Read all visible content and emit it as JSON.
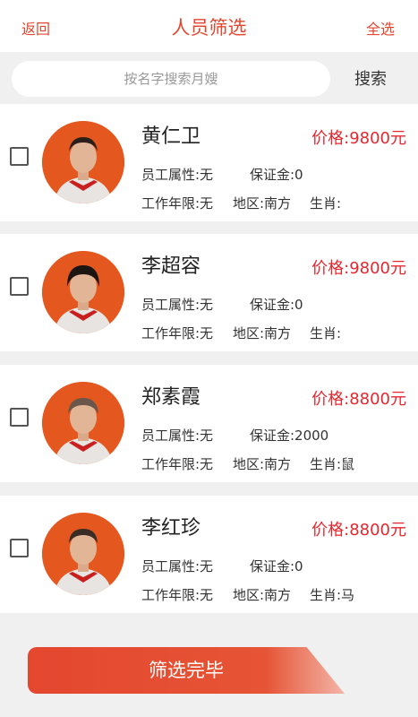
{
  "header": {
    "back_label": "返回",
    "title": "人员筛选",
    "select_all_label": "全选"
  },
  "search": {
    "placeholder": "按名字搜索月嫂",
    "button_label": "搜索"
  },
  "employees": [
    {
      "name": "黄仁卫",
      "price": "价格:9800元",
      "attribute": "员工属性:无",
      "deposit": "保证金:0",
      "years": "工作年限:无",
      "region": "地区:南方",
      "zodiac": "生肖:"
    },
    {
      "name": "李超容",
      "price": "价格:9800元",
      "attribute": "员工属性:无",
      "deposit": "保证金:0",
      "years": "工作年限:无",
      "region": "地区:南方",
      "zodiac": "生肖:"
    },
    {
      "name": "郑素霞",
      "price": "价格:8800元",
      "attribute": "员工属性:无",
      "deposit": "保证金:2000",
      "years": "工作年限:无",
      "region": "地区:南方",
      "zodiac": "生肖:鼠"
    },
    {
      "name": "李红珍",
      "price": "价格:8800元",
      "attribute": "员工属性:无",
      "deposit": "保证金:0",
      "years": "工作年限:无",
      "region": "地区:南方",
      "zodiac": "生肖:马"
    }
  ],
  "footer": {
    "finish_label": "筛选完毕"
  },
  "colors": {
    "accent": "#e4472f",
    "price": "#e4272f",
    "avatar_bg": "#e4571f"
  }
}
